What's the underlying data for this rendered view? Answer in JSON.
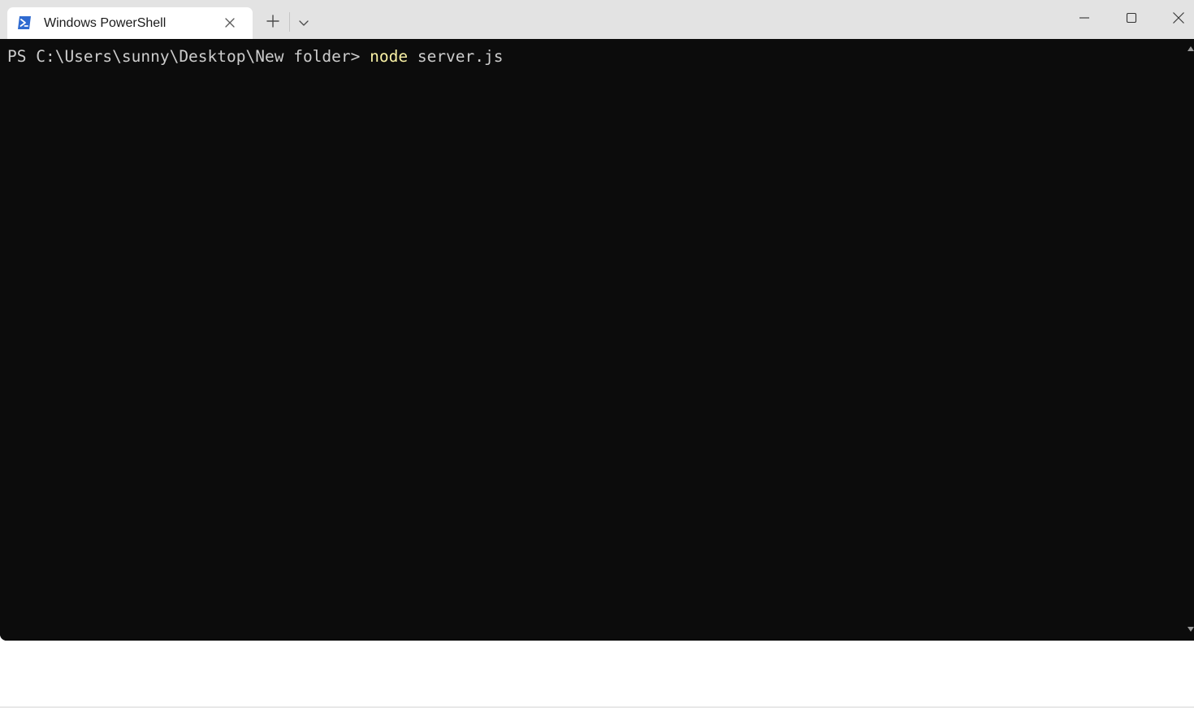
{
  "titlebar": {
    "tab_title": "Windows PowerShell",
    "tab_icon": "powershell-icon",
    "close_tab_icon": "close-icon",
    "new_tab_icon": "plus-icon",
    "dropdown_icon": "chevron-down-icon",
    "minimize_icon": "minimize-icon",
    "maximize_icon": "maximize-icon",
    "close_window_icon": "close-icon"
  },
  "terminal": {
    "prompt": "PS C:\\Users\\sunny\\Desktop\\New folder> ",
    "command": "node",
    "args": " server.js"
  },
  "colors": {
    "terminal_bg": "#0c0c0c",
    "text": "#cccccc",
    "command_highlight": "#f9f1a5",
    "tab_bg": "#ffffff",
    "titlebar_bg": "#e3e3e3",
    "accent": "#2f6ad0"
  }
}
